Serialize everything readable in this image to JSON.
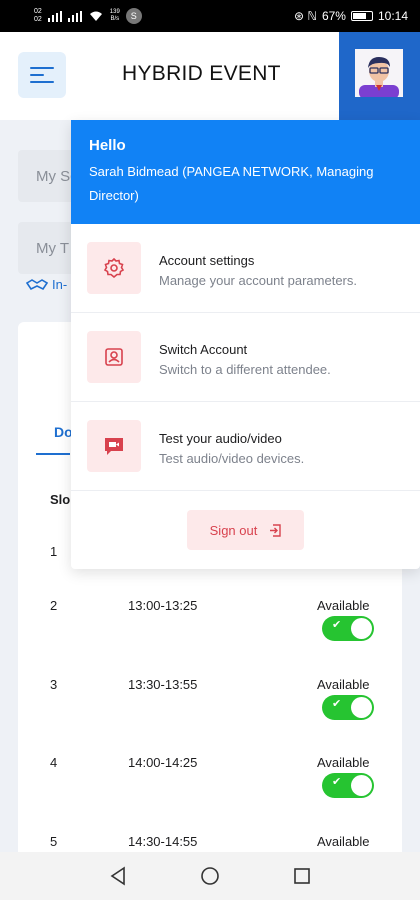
{
  "status_bar": {
    "sim_top": "02",
    "sim_bottom": "02",
    "speed_value": "139",
    "speed_unit": "B/s",
    "badge": "S",
    "icons_right": "⊛ ℕ",
    "battery": "67%",
    "time": "10:14"
  },
  "header": {
    "title": "HYBRID EVENT",
    "menu_icon": "hamburger-icon",
    "avatar": "user-avatar"
  },
  "background": {
    "field_1": "My Sc",
    "field_2": "My T",
    "in_person": "In-",
    "tab": "Do",
    "slot_header": "Slo",
    "rows": [
      {
        "num": "1",
        "time": "",
        "status": ""
      },
      {
        "num": "2",
        "time": "13:00-13:25",
        "status": "Available"
      },
      {
        "num": "3",
        "time": "13:30-13:55",
        "status": "Available"
      },
      {
        "num": "4",
        "time": "14:00-14:25",
        "status": "Available"
      },
      {
        "num": "5",
        "time": "14:30-14:55",
        "status": "Available"
      }
    ]
  },
  "dropdown": {
    "hello": "Hello",
    "user": "Sarah Bidmead (PANGEA NETWORK, Managing Director)",
    "items": [
      {
        "title": "Account settings",
        "desc": "Manage your account parameters.",
        "icon": "gear-icon"
      },
      {
        "title": "Switch Account",
        "desc": "Switch to a different attendee.",
        "icon": "contact-icon"
      },
      {
        "title": "Test your audio/video",
        "desc": "Test audio/video devices.",
        "icon": "video-icon"
      }
    ],
    "sign_out": "Sign out"
  },
  "colors": {
    "primary": "#1182f5",
    "accent_dark": "#1f67c9",
    "danger": "#d8424e",
    "danger_bg": "#fde9ea",
    "toggle_on": "#26c431"
  }
}
